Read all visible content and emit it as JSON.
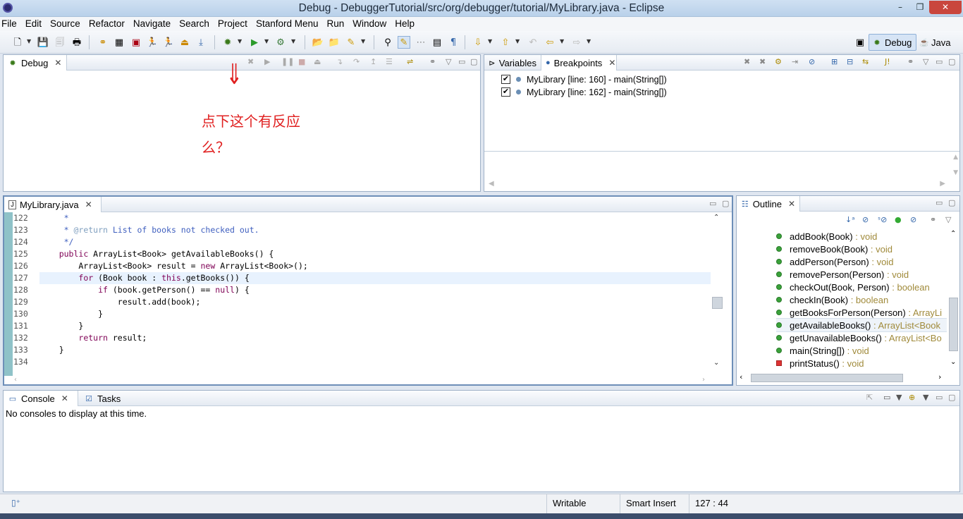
{
  "window": {
    "title": "Debug - DebuggerTutorial/src/org/debugger/tutorial/MyLibrary.java - Eclipse",
    "min": "–",
    "restore": "❐",
    "close": "✕"
  },
  "menubar": [
    "File",
    "Edit",
    "Source",
    "Refactor",
    "Navigate",
    "Search",
    "Project",
    "Stanford Menu",
    "Run",
    "Window",
    "Help"
  ],
  "perspectives": {
    "debug": "Debug",
    "java": "Java"
  },
  "debug_view": {
    "tab": "Debug"
  },
  "annotation": {
    "arrow": "⇓",
    "line1": "点下这个有反应",
    "line2": "么？",
    "color": "#e02020"
  },
  "var_view": {
    "tabs": [
      "Variables",
      "Breakpoints"
    ],
    "breakpoints": [
      "MyLibrary [line: 160] - main(String[])",
      "MyLibrary [line: 162] - main(String[])"
    ]
  },
  "editor": {
    "tab": "MyLibrary.java",
    "lines": [
      {
        "n": "122",
        "text": "     *"
      },
      {
        "n": "123",
        "text": "     * @return List of books not checked out."
      },
      {
        "n": "124",
        "text": "     */"
      },
      {
        "n": "125",
        "text": "    public ArrayList<Book> getAvailableBooks() {"
      },
      {
        "n": "126",
        "text": "        ArrayList<Book> result = new ArrayList<Book>();"
      },
      {
        "n": "127",
        "text": "        for (Book book : this.getBooks()) {"
      },
      {
        "n": "128",
        "text": "            if (book.getPerson() == null) {"
      },
      {
        "n": "129",
        "text": "                result.add(book);"
      },
      {
        "n": "130",
        "text": "            }"
      },
      {
        "n": "131",
        "text": "        }"
      },
      {
        "n": "132",
        "text": "        return result;"
      },
      {
        "n": "133",
        "text": "    }"
      },
      {
        "n": "134",
        "text": ""
      }
    ]
  },
  "outline": {
    "tab": "Outline",
    "items": [
      {
        "name": "addBook(Book)",
        "type": " : void",
        "kind": "method"
      },
      {
        "name": "removeBook(Book)",
        "type": " : void",
        "kind": "method"
      },
      {
        "name": "addPerson(Person)",
        "type": " : void",
        "kind": "method"
      },
      {
        "name": "removePerson(Person)",
        "type": " : void",
        "kind": "method"
      },
      {
        "name": "checkOut(Book, Person)",
        "type": " : boolean",
        "kind": "method"
      },
      {
        "name": "checkIn(Book)",
        "type": " : boolean",
        "kind": "method"
      },
      {
        "name": "getBooksForPerson(Person)",
        "type": " : ArrayLi",
        "kind": "method"
      },
      {
        "name": "getAvailableBooks()",
        "type": " : ArrayList<Book",
        "kind": "method",
        "selected": true
      },
      {
        "name": "getUnavailableBooks()",
        "type": " : ArrayList<Bo",
        "kind": "method"
      },
      {
        "name": "main(String[])",
        "type": " : void",
        "kind": "static"
      },
      {
        "name": "printStatus()",
        "type": " : void",
        "kind": "private"
      }
    ]
  },
  "console": {
    "tabs": [
      "Console",
      "Tasks"
    ],
    "message": "No consoles to display at this time."
  },
  "status": {
    "writable": "Writable",
    "insert": "Smart Insert",
    "position": "127 : 44"
  }
}
